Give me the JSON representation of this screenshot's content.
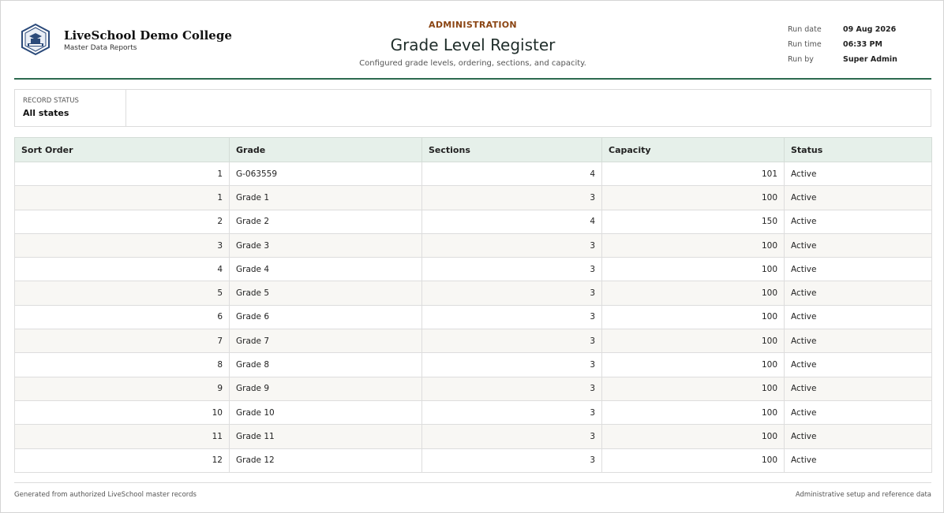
{
  "header": {
    "org_name": "LiveSchool Demo College",
    "org_subtitle": "Master Data Reports",
    "kicker": "ADMINISTRATION",
    "title": "Grade Level Register",
    "subtitle": "Configured grade levels, ordering, sections, and capacity.",
    "meta": [
      {
        "label": "Run date",
        "value": "09 Aug 2026"
      },
      {
        "label": "Run time",
        "value": "06:33 PM"
      },
      {
        "label": "Run by",
        "value": "Super Admin"
      }
    ]
  },
  "filters": {
    "record_status_label": "RECORD STATUS",
    "record_status_value": "All states"
  },
  "table": {
    "columns": [
      "Sort Order",
      "Grade",
      "Sections",
      "Capacity",
      "Status"
    ],
    "rows": [
      {
        "sort": "1",
        "grade": "G-063559",
        "sections": "4",
        "capacity": "101",
        "status": "Active"
      },
      {
        "sort": "1",
        "grade": "Grade 1",
        "sections": "3",
        "capacity": "100",
        "status": "Active"
      },
      {
        "sort": "2",
        "grade": "Grade 2",
        "sections": "4",
        "capacity": "150",
        "status": "Active"
      },
      {
        "sort": "3",
        "grade": "Grade 3",
        "sections": "3",
        "capacity": "100",
        "status": "Active"
      },
      {
        "sort": "4",
        "grade": "Grade 4",
        "sections": "3",
        "capacity": "100",
        "status": "Active"
      },
      {
        "sort": "5",
        "grade": "Grade 5",
        "sections": "3",
        "capacity": "100",
        "status": "Active"
      },
      {
        "sort": "6",
        "grade": "Grade 6",
        "sections": "3",
        "capacity": "100",
        "status": "Active"
      },
      {
        "sort": "7",
        "grade": "Grade 7",
        "sections": "3",
        "capacity": "100",
        "status": "Active"
      },
      {
        "sort": "8",
        "grade": "Grade 8",
        "sections": "3",
        "capacity": "100",
        "status": "Active"
      },
      {
        "sort": "9",
        "grade": "Grade 9",
        "sections": "3",
        "capacity": "100",
        "status": "Active"
      },
      {
        "sort": "10",
        "grade": "Grade 10",
        "sections": "3",
        "capacity": "100",
        "status": "Active"
      },
      {
        "sort": "11",
        "grade": "Grade 11",
        "sections": "3",
        "capacity": "100",
        "status": "Active"
      },
      {
        "sort": "12",
        "grade": "Grade 12",
        "sections": "3",
        "capacity": "100",
        "status": "Active"
      }
    ]
  },
  "footer": {
    "left": "Generated from authorized LiveSchool master records",
    "right": "Administrative setup and reference data"
  },
  "colors": {
    "accent_rule": "#2d6a4f",
    "kicker": "#8b4513",
    "header_fill": "#e6f0ea"
  },
  "icons": {
    "logo": "school-crest-icon"
  }
}
